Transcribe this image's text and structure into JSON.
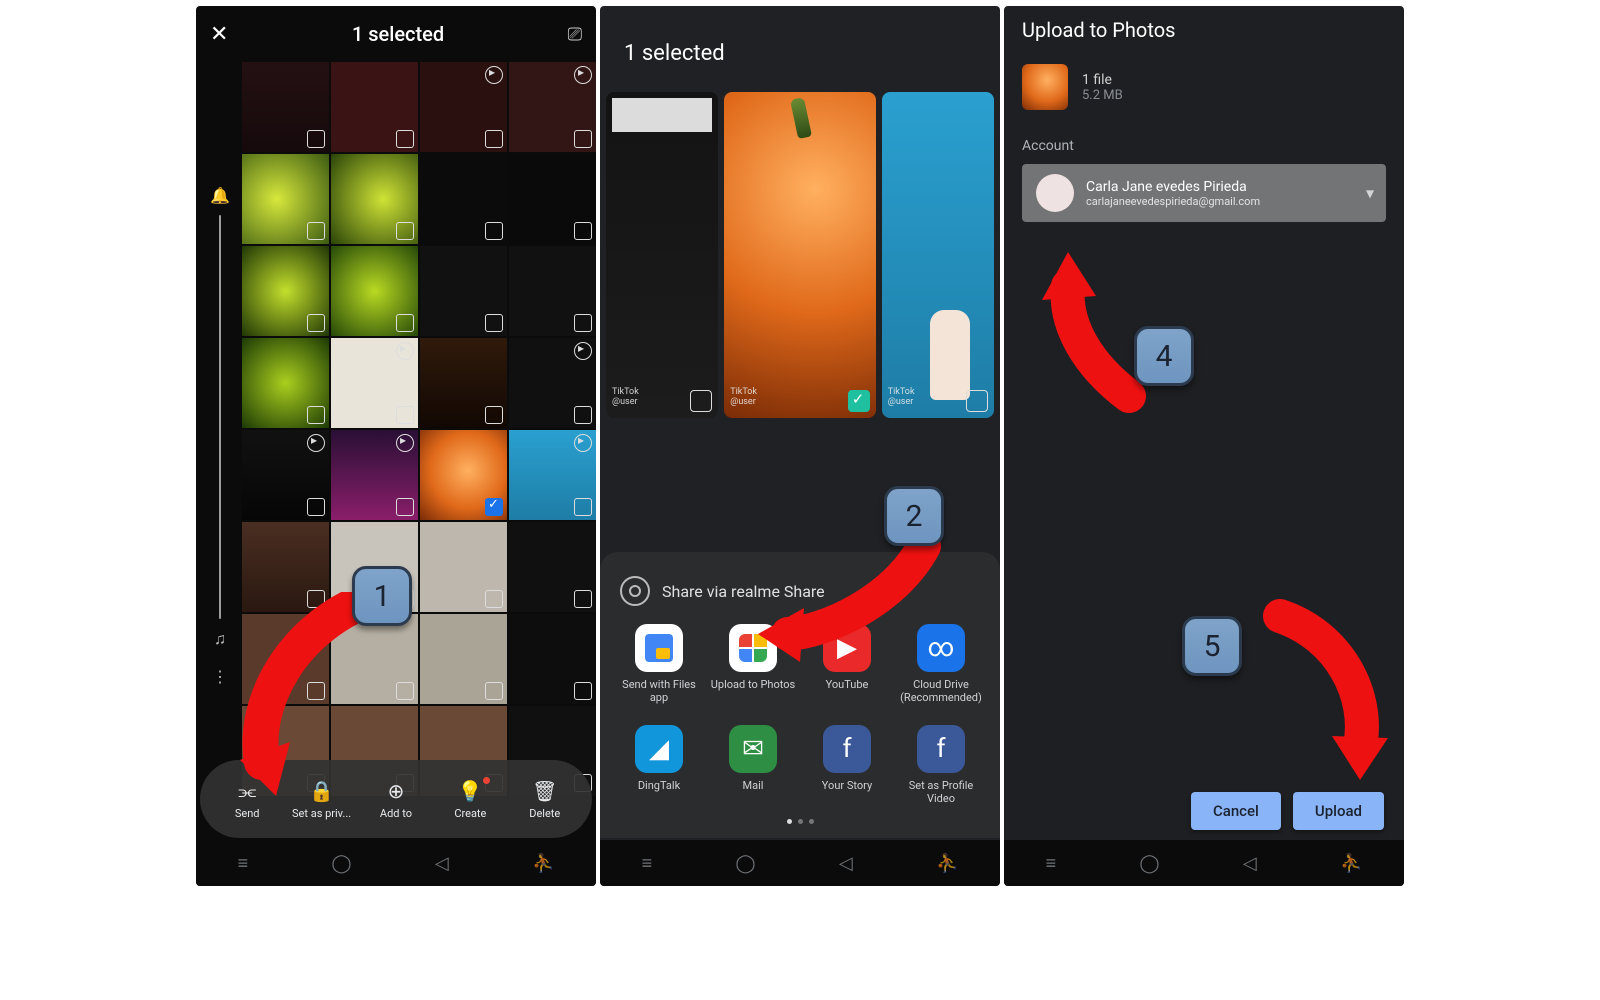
{
  "phone1": {
    "title": "1 selected",
    "toolbar": [
      {
        "label": "Send"
      },
      {
        "label": "Set as priv..."
      },
      {
        "label": "Add to"
      },
      {
        "label": "Create",
        "badge": true
      },
      {
        "label": "Delete"
      }
    ]
  },
  "phone2": {
    "title": "1 selected",
    "share_label": "Share via realme Share",
    "apps": [
      {
        "label": "Send with Files app"
      },
      {
        "label": "Upload to Photos"
      },
      {
        "label": "YouTube"
      },
      {
        "label": "Cloud Drive (Recommended)"
      },
      {
        "label": "DingTalk"
      },
      {
        "label": "Mail"
      },
      {
        "label": "Your Story"
      },
      {
        "label": "Set as Profile Video"
      }
    ]
  },
  "phone3": {
    "title": "Upload to Photos",
    "file_count": "1 file",
    "file_size": "5.2 MB",
    "account_label": "Account",
    "account_name": "Carla Jane evedes Pirieda",
    "account_email": "carlajaneevedespirieda@gmail.com",
    "cancel": "Cancel",
    "upload": "Upload"
  },
  "steps": {
    "s1": "1",
    "s2": "2",
    "s4": "4",
    "s5": "5"
  }
}
